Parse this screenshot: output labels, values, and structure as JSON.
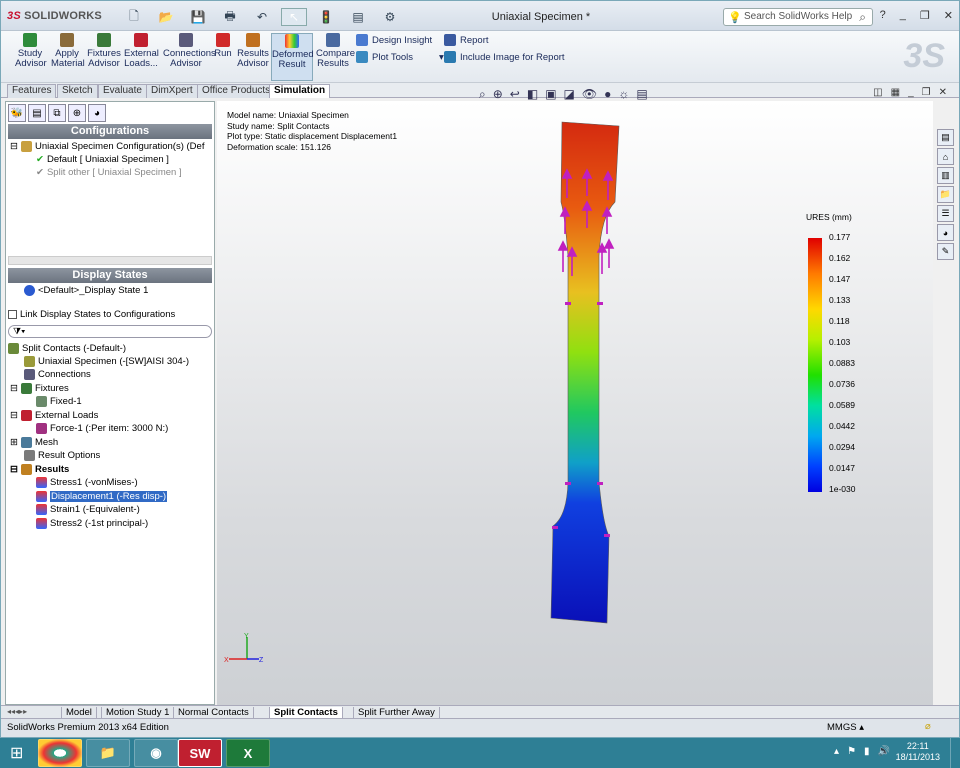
{
  "app": {
    "logo_ds": "3S",
    "logo_name": "SOLIDWORKS",
    "title": "Uniaxial Specimen *",
    "help_placeholder": "Search SolidWorks Help"
  },
  "quick_access": [
    "new-icon",
    "open-icon",
    "save-icon",
    "print-icon",
    "undo-icon",
    "select-icon",
    "rebuild-icon",
    "file-props-icon",
    "options-icon"
  ],
  "ribbon": {
    "buttons": [
      {
        "label": "Study\nAdvisor",
        "name": "study-advisor-button"
      },
      {
        "label": "Apply\nMaterial",
        "name": "apply-material-button"
      },
      {
        "label": "Fixtures\nAdvisor",
        "name": "fixtures-advisor-button"
      },
      {
        "label": "External\nLoads...",
        "name": "external-loads-button"
      },
      {
        "label": "Connections\nAdvisor",
        "name": "connections-advisor-button"
      },
      {
        "label": "Run",
        "name": "run-button"
      },
      {
        "label": "Results\nAdvisor",
        "name": "results-advisor-button"
      },
      {
        "label": "Deformed\nResult",
        "name": "deformed-result-button"
      },
      {
        "label": "Compare\nResults",
        "name": "compare-results-button"
      }
    ],
    "design_insight": "Design Insight",
    "plot_tools": "Plot Tools",
    "report": "Report",
    "include_image": "Include Image for Report"
  },
  "cmd_tabs": [
    "Features",
    "Sketch",
    "Evaluate",
    "DimXpert",
    "Office Products",
    "Simulation"
  ],
  "config": {
    "header": "Configurations",
    "root": "Uniaxial Specimen Configuration(s)  (Def",
    "items": [
      "Default [ Uniaxial Specimen ]",
      "Split other [ Uniaxial Specimen ]"
    ]
  },
  "display_states": {
    "header": "Display States",
    "item": "<Default>_Display State 1",
    "link_label": "Link Display States to Configurations"
  },
  "tree": {
    "root": "Split Contacts (-Default-)",
    "items": [
      "Uniaxial Specimen (-[SW]AISI 304-)",
      "Connections",
      "Fixtures",
      "Fixed-1",
      "External Loads",
      "Force-1 (:Per item: 3000 N:)",
      "Mesh",
      "Result Options",
      "Results",
      "Stress1 (-vonMises-)",
      "Displacement1 (-Res disp-)",
      "Strain1 (-Equivalent-)",
      "Stress2 (-1st principal-)"
    ]
  },
  "plot_info": [
    "Model name: Uniaxial Specimen",
    "Study name: Split Contacts",
    "Plot type: Static displacement Displacement1",
    "Deformation scale: 151.126"
  ],
  "legend": {
    "title": "URES (mm)",
    "values": [
      "0.177",
      "0.162",
      "0.147",
      "0.133",
      "0.118",
      "0.103",
      "0.0883",
      "0.0736",
      "0.0589",
      "0.0442",
      "0.0294",
      "0.0147",
      "1e-030"
    ]
  },
  "bottom_tabs": [
    "Model",
    "Motion Study 1",
    "Normal Contacts",
    "Split Contacts",
    "Split Further Away"
  ],
  "status": {
    "edition": "SolidWorks Premium 2013 x64 Edition",
    "units": "MMGS"
  },
  "taskbar": {
    "time": "22:11",
    "date": "18/11/2013"
  }
}
